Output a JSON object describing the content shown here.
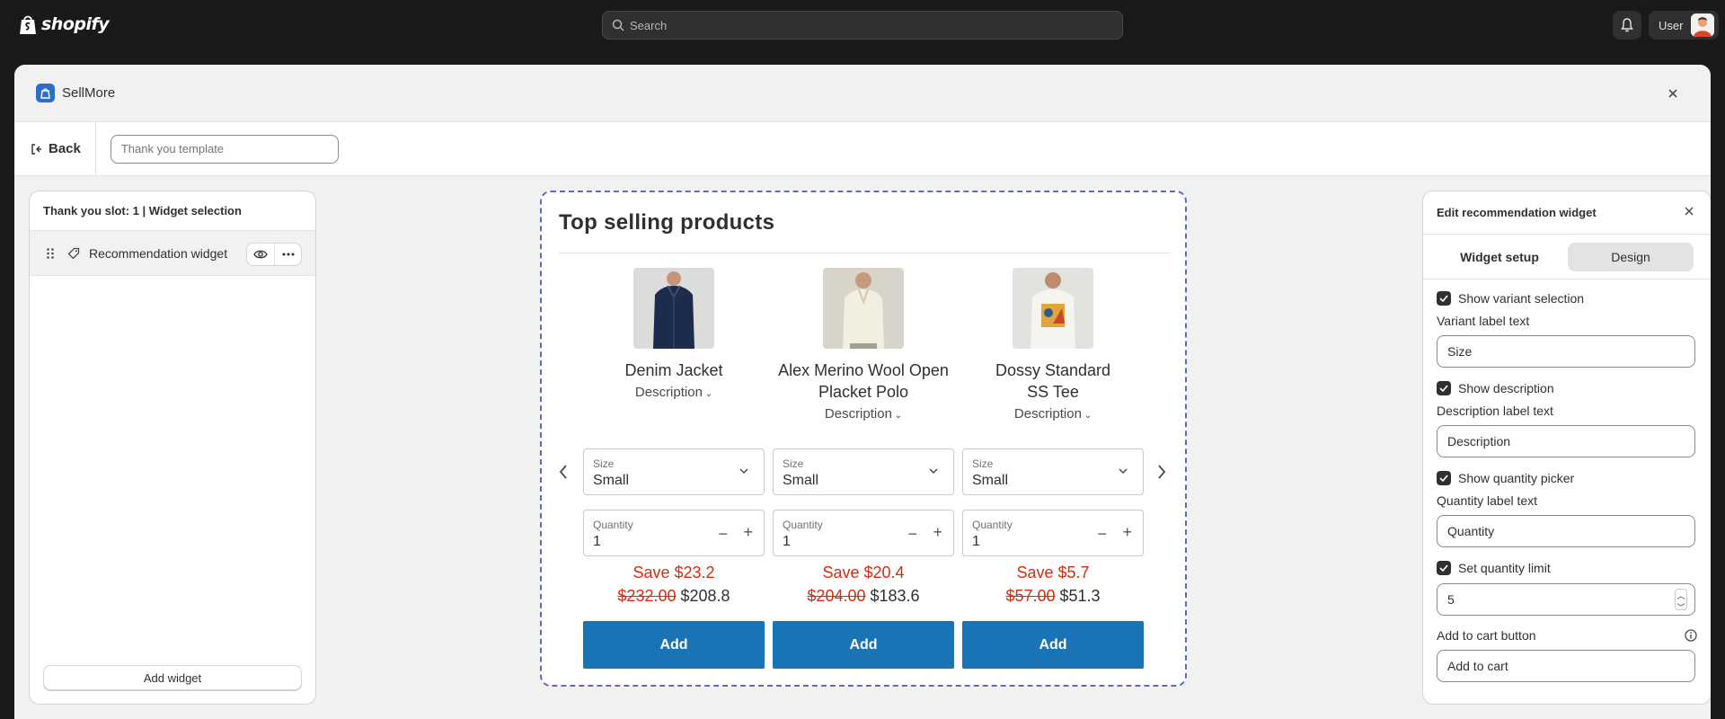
{
  "topbar": {
    "brand": "shopify",
    "search_placeholder": "Search",
    "user_label": "User"
  },
  "modal": {
    "app_name": "SellMore",
    "back_label": "Back",
    "template_placeholder": "Thank you template"
  },
  "left_panel": {
    "title": "Thank you slot: 1 | Widget selection",
    "widget_label": "Recommendation widget",
    "add_widget_label": "Add widget"
  },
  "preview": {
    "title": "Top selling products",
    "products": [
      {
        "name": "Denim Jacket",
        "description_label": "Description",
        "size_label": "Size",
        "size_value": "Small",
        "quantity_label": "Quantity",
        "quantity_value": "1",
        "save_text": "Save $23.2",
        "original_price": "$232.00",
        "price": "$208.8",
        "add_label": "Add"
      },
      {
        "name": "Alex Merino Wool Open Placket Polo",
        "description_label": "Description",
        "size_label": "Size",
        "size_value": "Small",
        "quantity_label": "Quantity",
        "quantity_value": "1",
        "save_text": "Save $20.4",
        "original_price": "$204.00",
        "price": "$183.6",
        "add_label": "Add"
      },
      {
        "name": "Dossy Standard SS Tee",
        "description_label": "Description",
        "size_label": "Size",
        "size_value": "Small",
        "quantity_label": "Quantity",
        "quantity_value": "1",
        "save_text": "Save $5.7",
        "original_price": "$57.00",
        "price": "$51.3",
        "add_label": "Add"
      }
    ]
  },
  "right_panel": {
    "title": "Edit recommendation widget",
    "tabs": [
      "Widget setup",
      "Design"
    ],
    "active_tab": "Design",
    "show_variant_selection": "Show variant selection",
    "variant_label_text": "Variant label text",
    "variant_label_value": "Size",
    "show_description": "Show description",
    "description_label_text": "Description label text",
    "description_label_value": "Description",
    "show_quantity_picker": "Show quantity picker",
    "quantity_label_text": "Quantity label text",
    "quantity_label_value": "Quantity",
    "set_quantity_limit": "Set quantity limit",
    "quantity_limit_value": "5",
    "add_to_cart_label": "Add to cart button",
    "add_to_cart_value": "Add to cart"
  },
  "colors": {
    "accent_button": "#1a73b5",
    "sale_red": "#d72c0d",
    "dashed_border": "#5c6ac4"
  }
}
